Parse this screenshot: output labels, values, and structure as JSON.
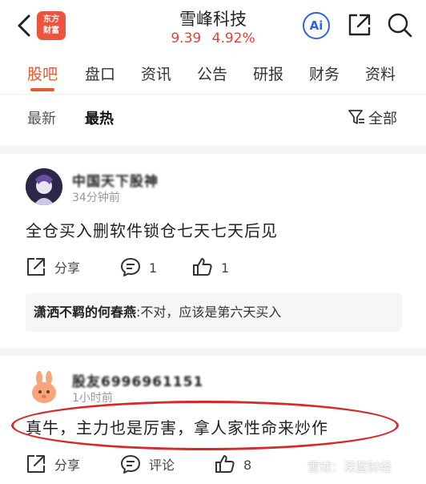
{
  "header": {
    "logo_text": "东方财富",
    "stock_name": "雪峰科技",
    "price": "9.39",
    "change_pct": "4.92%",
    "ai_label": "Ai",
    "quote_color": "#e8413a",
    "logo_color": "#f0533b",
    "ai_color": "#2c64e3"
  },
  "tabs": [
    "股吧",
    "盘口",
    "资讯",
    "公告",
    "研报",
    "财务",
    "资料"
  ],
  "active_tab": "股吧",
  "accent_color": "#e8582c",
  "subtabs": [
    "最新",
    "最热"
  ],
  "active_subtab": "最热",
  "filter_label": "全部",
  "posts": [
    {
      "username": "中国天下股神",
      "time": "34分钟前",
      "content": "全仓买入删软件锁仓七天七天后见",
      "share_label": "分享",
      "comment_count": "1",
      "like_count": "1",
      "reply": {
        "author": "潇洒不羁的何春燕",
        "text": ":不对，应该是第六天买入"
      }
    },
    {
      "username": "股友6996961151",
      "time": "1小时前",
      "content": "真牛，主力也是厉害，拿人家性命来炒作",
      "share_label": "分享",
      "comment_label": "评论",
      "like_count": "8"
    }
  ],
  "watermark": "雪球：深蓝财经",
  "highlight_color": "#d42a2a"
}
